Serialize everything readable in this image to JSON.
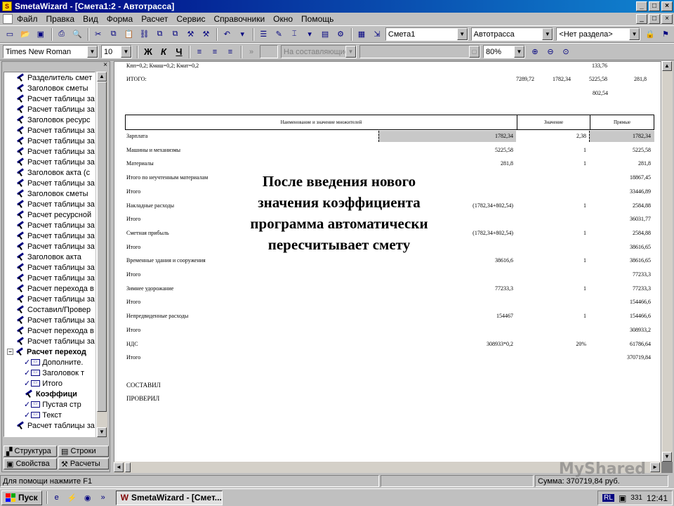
{
  "window": {
    "title": "SmetaWizard - [Смета1:2 - Автотрасса]",
    "controls": [
      "_",
      "□",
      "×"
    ]
  },
  "menu": [
    "Файл",
    "Правка",
    "Вид",
    "Форма",
    "Расчет",
    "Сервис",
    "Справочники",
    "Окно",
    "Помощь"
  ],
  "toolbar": {
    "estimate_combo": "Смета1",
    "object_combo": "Автотрасса",
    "section_combo": "<Нет раздела>",
    "font_combo": "Times New Roman",
    "size_combo": "10",
    "style_buttons": [
      "Ж",
      "К",
      "Ч"
    ],
    "accumulate_combo": "На составляющие",
    "zoom_combo": "80%"
  },
  "tree": [
    {
      "label": "Разделитель смет",
      "type": "hammer",
      "indent": 1
    },
    {
      "label": "Заголовок сметы",
      "type": "hammer",
      "indent": 1
    },
    {
      "label": "Расчет таблицы за",
      "type": "hammer",
      "indent": 1
    },
    {
      "label": "Расчет таблицы за",
      "type": "hammer",
      "indent": 1
    },
    {
      "label": "Заголовок ресурс",
      "type": "hammer",
      "indent": 1
    },
    {
      "label": "Расчет таблицы за",
      "type": "hammer",
      "indent": 1
    },
    {
      "label": "Расчет таблицы за",
      "type": "hammer",
      "indent": 1
    },
    {
      "label": "Расчет таблицы за",
      "type": "hammer",
      "indent": 1
    },
    {
      "label": "Расчет таблицы за",
      "type": "hammer",
      "indent": 1
    },
    {
      "label": "Заголовок акта (с",
      "type": "hammer",
      "indent": 1
    },
    {
      "label": "Расчет таблицы за",
      "type": "hammer",
      "indent": 1
    },
    {
      "label": "Заголовок сметы",
      "type": "hammer",
      "indent": 1
    },
    {
      "label": "Расчет таблицы за",
      "type": "hammer",
      "indent": 1
    },
    {
      "label": "Расчет ресурсной",
      "type": "hammer",
      "indent": 1
    },
    {
      "label": "Расчет таблицы за",
      "type": "hammer",
      "indent": 1
    },
    {
      "label": "Расчет таблицы за",
      "type": "hammer",
      "indent": 1
    },
    {
      "label": "Расчет таблицы за",
      "type": "hammer",
      "indent": 1
    },
    {
      "label": "Заголовок акта",
      "type": "hammer",
      "indent": 1
    },
    {
      "label": "Расчет таблицы за",
      "type": "hammer",
      "indent": 1
    },
    {
      "label": "Расчет таблицы за",
      "type": "hammer",
      "indent": 1
    },
    {
      "label": "Расчет перехода в",
      "type": "hammer",
      "indent": 1
    },
    {
      "label": "Расчет таблицы за",
      "type": "hammer",
      "indent": 1
    },
    {
      "label": "Составил/Провер",
      "type": "hammer",
      "indent": 1
    },
    {
      "label": "Расчет таблицы за",
      "type": "hammer",
      "indent": 1
    },
    {
      "label": "Расчет перехода в",
      "type": "hammer",
      "indent": 1
    },
    {
      "label": "Расчет таблицы за",
      "type": "hammer",
      "indent": 1
    },
    {
      "label": "Расчет переход",
      "type": "hammer",
      "indent": 0,
      "bold": true
    },
    {
      "label": "Дополните.",
      "type": "doc",
      "indent": 2
    },
    {
      "label": "Заголовок т",
      "type": "doc",
      "indent": 2
    },
    {
      "label": "Итого",
      "type": "doc",
      "indent": 2
    },
    {
      "label": "Коэффици",
      "type": "hammer",
      "indent": 2,
      "bold": true
    },
    {
      "label": "Пустая стр",
      "type": "doc",
      "indent": 2
    },
    {
      "label": "Текст",
      "type": "doc",
      "indent": 2
    },
    {
      "label": "Расчет таблицы за",
      "type": "hammer",
      "indent": 1
    }
  ],
  "left_tabs": {
    "structure": "Структура",
    "rows": "Строки",
    "properties": "Свойства",
    "calcs": "Расчеты"
  },
  "doc": {
    "top_coef_line": "Кпп=0,2; Кмаш=0,2; Кмат=0,2",
    "top_total_label": "ИТОГО:",
    "top_row_values": [
      "133,76"
    ],
    "top_total_values": [
      "7289,72",
      "1782,34",
      "5225,58",
      "281,8"
    ],
    "top_extra_value": "802,54",
    "table_header": [
      "Наименование и значение множителей",
      "Значение",
      "Прямые"
    ],
    "rows": [
      {
        "name": "Зарплата",
        "mid": "1782,34",
        "value": "2,38",
        "direct": "1782,34",
        "highlight": true
      },
      {
        "name": "Машины и механизмы",
        "mid": "5225,58",
        "value": "1",
        "direct": "5225,58"
      },
      {
        "name": "Материалы",
        "mid": "281,8",
        "value": "1",
        "direct": "281,8"
      },
      {
        "name": "Итого по неучтенным материалам",
        "mid": "",
        "value": "",
        "direct": "18867,45"
      },
      {
        "name": "Итого",
        "mid": "",
        "value": "",
        "direct": "33446,89"
      },
      {
        "name": "Накладные расходы",
        "mid": "(1782,34+802,54)",
        "value": "1",
        "direct": "2584,88"
      },
      {
        "name": "Итого",
        "mid": "",
        "value": "",
        "direct": "36031,77"
      },
      {
        "name": "Сметная прибыль",
        "mid": "(1782,34+802,54)",
        "value": "1",
        "direct": "2584,88"
      },
      {
        "name": "Итого",
        "mid": "",
        "value": "",
        "direct": "38616,65"
      },
      {
        "name": "Временные здания и сооружения",
        "mid": "38616,6",
        "value": "1",
        "direct": "38616,65"
      },
      {
        "name": "Итого",
        "mid": "",
        "value": "",
        "direct": "77233,3"
      },
      {
        "name": "Зимнее удорожание",
        "mid": "77233,3",
        "value": "1",
        "direct": "77233,3"
      },
      {
        "name": "Итого",
        "mid": "",
        "value": "",
        "direct": "154466,6"
      },
      {
        "name": "Непредвиденные расходы",
        "mid": "154467",
        "value": "1",
        "direct": "154466,6"
      },
      {
        "name": "Итого",
        "mid": "",
        "value": "",
        "direct": "308933,2"
      },
      {
        "name": "НДС",
        "mid": "308933*0,2",
        "value": "20%",
        "direct": "61786,64"
      },
      {
        "name": "Итого",
        "mid": "",
        "value": "",
        "direct": "370719,84"
      }
    ],
    "compiled": "СОСТАВИЛ",
    "checked": "ПРОВЕРИЛ",
    "overlay": [
      "После введения нового",
      "значения коэффициента",
      "программа автоматически",
      "пересчитывает смету"
    ]
  },
  "status": {
    "help": "Для помощи нажмите F1",
    "sum": "Сумма: 370719,84 руб."
  },
  "taskbar": {
    "start": "Пуск",
    "task": "SmetaWizard - [Смет...",
    "lang": "RL",
    "tray_num": "331",
    "clock": "12:41"
  },
  "watermark": "MyShared"
}
